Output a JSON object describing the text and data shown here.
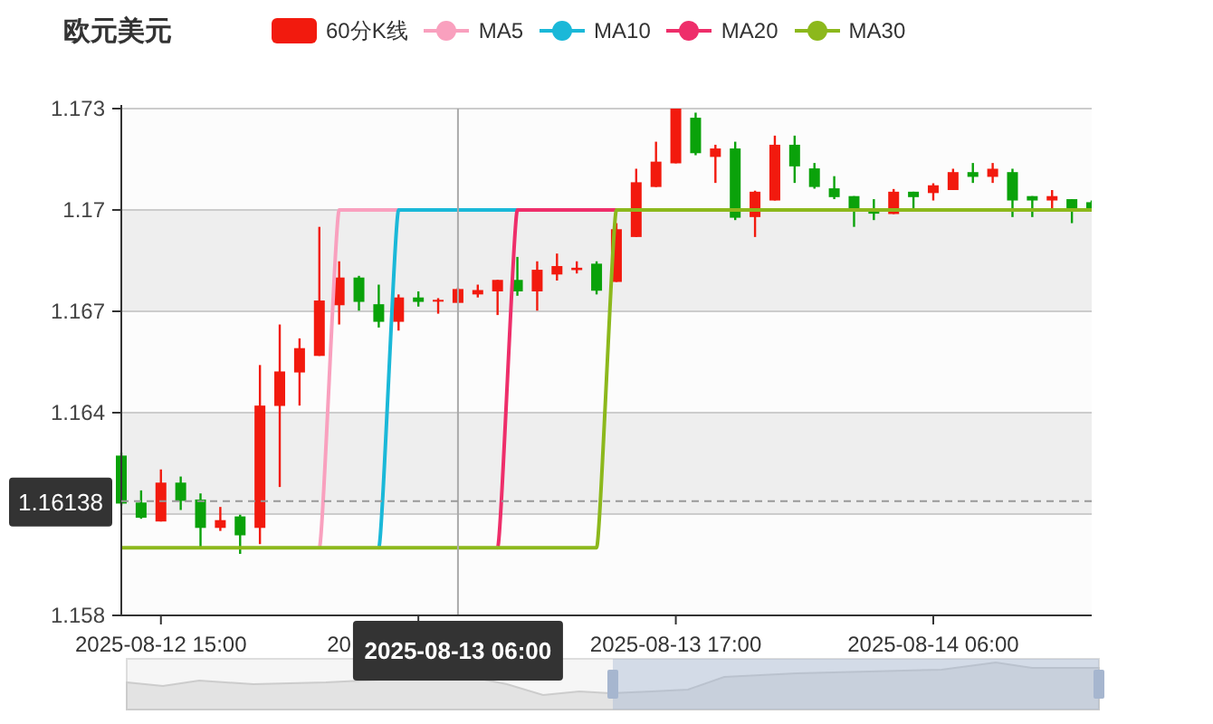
{
  "title": "欧元美元",
  "legend": {
    "items": [
      {
        "kind": "candle",
        "label": "60分K线",
        "color": "#f21a0e",
        "selected": true
      },
      {
        "kind": "line",
        "label": "MA5",
        "color": "#f9a0be",
        "selected": true
      },
      {
        "kind": "line",
        "label": "MA10",
        "color": "#1ab8d8",
        "selected": true
      },
      {
        "kind": "line",
        "label": "MA20",
        "color": "#ee2e6a",
        "selected": true
      },
      {
        "kind": "line",
        "label": "MA30",
        "color": "#8cb81c",
        "selected": true
      }
    ]
  },
  "chart": {
    "chart_data": {
      "type": "candlestick",
      "categories": [
        null,
        null,
        "2025-08-12 15:00",
        null,
        null,
        null,
        null,
        null,
        null,
        null,
        null,
        null,
        null,
        null,
        null,
        null,
        null,
        "2025-08-13 06:00",
        null,
        null,
        null,
        null,
        null,
        null,
        null,
        null,
        null,
        null,
        "2025-08-13 17:00",
        null,
        null,
        null,
        null,
        null,
        null,
        null,
        null,
        null,
        null,
        null,
        null,
        "2025-08-14 06:00",
        null,
        null,
        null,
        null,
        null,
        null,
        null,
        null
      ],
      "ylim": [
        1.158,
        1.173
      ],
      "yticks": [
        1.158,
        1.164,
        1.167,
        1.17,
        1.173
      ],
      "grid": true,
      "bands": [
        {
          "axis": "y",
          "from": 1.167,
          "to": 1.17
        },
        {
          "axis": "y",
          "from": 1.161,
          "to": 1.164
        }
      ],
      "ohlc": [
        [
          1.16273,
          1.16282,
          1.16125,
          1.16131
        ],
        [
          1.16134,
          1.1617,
          1.16086,
          1.16089
        ],
        [
          1.16078,
          1.16232,
          1.16078,
          1.16193
        ],
        [
          1.16193,
          1.16211,
          1.16112,
          1.16139
        ],
        [
          1.16143,
          1.16161,
          1.15999,
          1.16059
        ],
        [
          1.16059,
          1.16121,
          1.1605,
          1.16082
        ],
        [
          1.16093,
          1.16098,
          1.15982,
          1.16037
        ],
        [
          1.16059,
          1.16541,
          1.16011,
          1.16421
        ],
        [
          1.1642,
          1.16661,
          1.1618,
          1.16522
        ],
        [
          1.16519,
          1.1662,
          1.16421,
          1.16591
        ],
        [
          1.16568,
          1.1695,
          1.16568,
          1.16732
        ],
        [
          1.16718,
          1.16848,
          1.16661,
          1.168
        ],
        [
          1.168,
          1.16805,
          1.16702,
          1.16728
        ],
        [
          1.16721,
          1.16779,
          1.16652,
          1.16669
        ],
        [
          1.16669,
          1.1675,
          1.16643,
          1.16741
        ],
        [
          1.16741,
          1.16759,
          1.16714,
          1.16728
        ],
        [
          1.16731,
          1.16739,
          1.16693,
          1.16734
        ],
        [
          1.16725,
          1.1677,
          1.16725,
          1.16766
        ],
        [
          1.1675,
          1.16779,
          1.16741,
          1.16763
        ],
        [
          1.16759,
          1.16793,
          1.16689,
          1.16793
        ],
        [
          1.16793,
          1.16861,
          1.16746,
          1.16759
        ],
        [
          1.16759,
          1.16848,
          1.16702,
          1.16823
        ],
        [
          1.16809,
          1.16871,
          1.16791,
          1.16834
        ],
        [
          1.16822,
          1.16848,
          1.16812,
          1.16829
        ],
        [
          1.16841,
          1.16848,
          1.1675,
          1.16761
        ],
        [
          1.16787,
          1.16961,
          1.16787,
          1.16943
        ],
        [
          1.1692,
          1.17122,
          1.1692,
          1.17082
        ],
        [
          1.17068,
          1.17202,
          1.17068,
          1.17143
        ],
        [
          1.17138,
          1.173,
          1.17138,
          1.173
        ],
        [
          1.17273,
          1.17288,
          1.17162,
          1.17168
        ],
        [
          1.17157,
          1.17193,
          1.1708,
          1.17182
        ],
        [
          1.17182,
          1.17202,
          1.1697,
          1.16977
        ],
        [
          1.16979,
          1.17057,
          1.1692,
          1.17054
        ],
        [
          1.17028,
          1.1722,
          1.17028,
          1.17193
        ],
        [
          1.17193,
          1.1722,
          1.1708,
          1.17129
        ],
        [
          1.17123,
          1.17139,
          1.17063,
          1.17068
        ],
        [
          1.17064,
          1.171,
          1.17032,
          1.17038
        ],
        [
          1.17041,
          1.17041,
          1.1695,
          1.17
        ],
        [
          1.17004,
          1.17032,
          1.1697,
          1.16989
        ],
        [
          1.16988,
          1.17062,
          1.16988,
          1.17054
        ],
        [
          1.17054,
          1.17054,
          1.17,
          1.17038
        ],
        [
          1.1705,
          1.17079,
          1.17028,
          1.17073
        ],
        [
          1.17059,
          1.17122,
          1.17059,
          1.17112
        ],
        [
          1.17112,
          1.17139,
          1.1708,
          1.17098
        ],
        [
          1.17098,
          1.17139,
          1.1708,
          1.17122
        ],
        [
          1.17112,
          1.17122,
          1.16979,
          1.17028
        ],
        [
          1.17041,
          1.17041,
          1.16979,
          1.17028
        ],
        [
          1.17028,
          1.17059,
          1.17,
          1.17041
        ],
        [
          1.17032,
          1.17032,
          1.16961,
          1.17
        ],
        [
          1.17023,
          1.17028,
          1.17,
          1.17
        ]
      ],
      "series": [
        {
          "type": "line",
          "color": "#f9a0be",
          "values": [
            null,
            null,
            null,
            null,
            null,
            null,
            null,
            null,
            null,
            null,
            1.16,
            1.17,
            1.17,
            1.17,
            1.17,
            null,
            null,
            null,
            null,
            null,
            null,
            null,
            null,
            null,
            null,
            null,
            null,
            null,
            null,
            null,
            null,
            null,
            null,
            null,
            null,
            null,
            null,
            null,
            null,
            null,
            null,
            null,
            null,
            null,
            null,
            null,
            null,
            null,
            null,
            null
          ]
        },
        {
          "type": "line",
          "color": "#1ab8d8",
          "values": [
            null,
            null,
            null,
            null,
            null,
            null,
            null,
            null,
            null,
            null,
            null,
            null,
            null,
            1.16,
            1.17,
            1.17,
            1.17,
            1.17,
            1.17,
            1.17,
            1.17,
            null,
            null,
            null,
            null,
            null,
            null,
            null,
            null,
            null,
            null,
            null,
            null,
            null,
            null,
            null,
            null,
            null,
            null,
            null,
            null,
            null,
            null,
            null,
            null,
            null,
            null,
            null,
            null,
            null
          ]
        },
        {
          "type": "line",
          "color": "#ee2e6a",
          "values": [
            null,
            null,
            null,
            null,
            null,
            null,
            null,
            null,
            null,
            null,
            null,
            null,
            null,
            null,
            null,
            null,
            null,
            null,
            null,
            1.16,
            1.17,
            1.17,
            1.17,
            1.17,
            1.17,
            1.17,
            null,
            null,
            null,
            null,
            null,
            null,
            null,
            null,
            null,
            null,
            null,
            null,
            null,
            null,
            null,
            null,
            null,
            null,
            null,
            null,
            null,
            null,
            null,
            null
          ]
        },
        {
          "type": "line",
          "color": "#8cb81c",
          "values": [
            1.16,
            1.16,
            1.16,
            1.16,
            1.16,
            1.16,
            1.16,
            1.16,
            1.16,
            1.16,
            1.16,
            1.16,
            1.16,
            1.16,
            1.16,
            1.16,
            1.16,
            1.16,
            1.16,
            1.16,
            1.16,
            1.16,
            1.16,
            1.16,
            1.16,
            1.17,
            1.17,
            1.17,
            1.17,
            1.17,
            1.17,
            1.17,
            1.17,
            1.17,
            1.17,
            1.17,
            1.17,
            1.17,
            1.17,
            1.17,
            1.17,
            1.17,
            1.17,
            1.17,
            1.17,
            1.17,
            1.17,
            1.17,
            1.17,
            1.17
          ]
        }
      ],
      "ref_lines": [
        {
          "axis": "x",
          "value": "2025-08-13 06:00"
        },
        {
          "axis": "y",
          "value": 1.16138,
          "label": "1.16138"
        }
      ]
    },
    "covered_axis_label": "20",
    "zoom_slider": {
      "range_start": {
        "level": 0.5
      },
      "range_end": {
        "level": 1
      }
    }
  }
}
